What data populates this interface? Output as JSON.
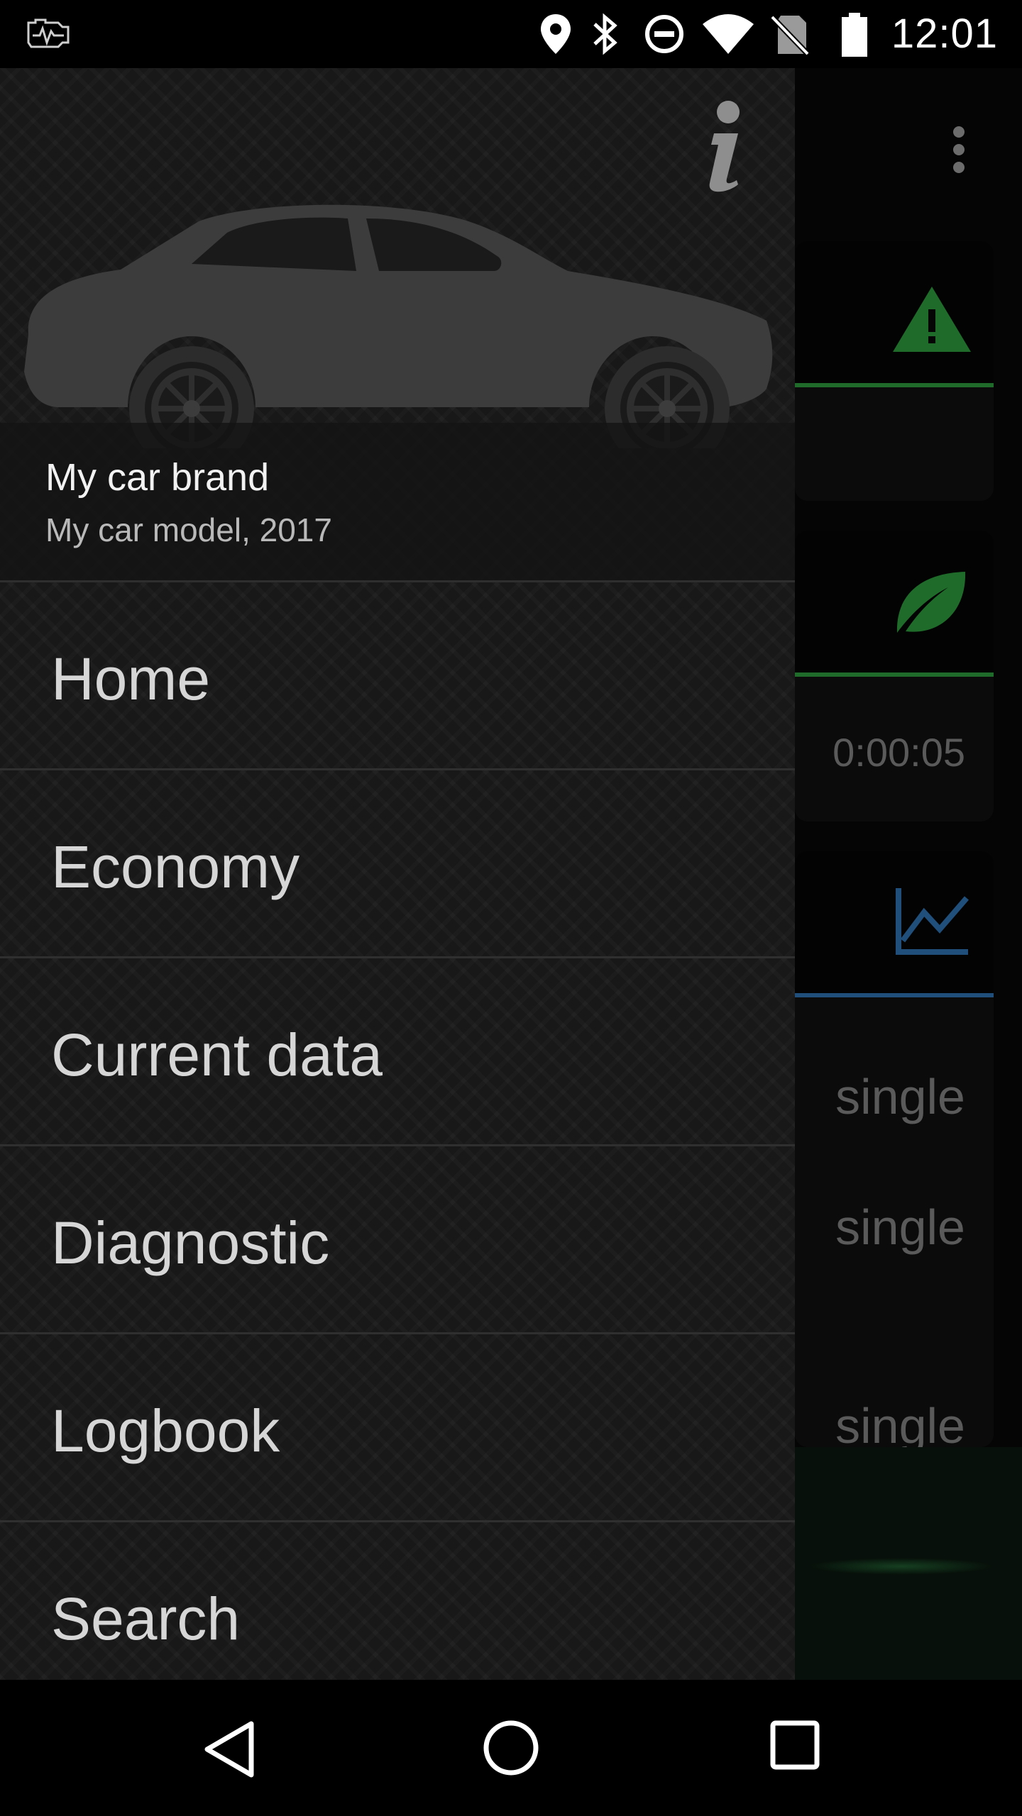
{
  "status_bar": {
    "time": "12:01",
    "icons": [
      "engine-monitor-icon",
      "location-pin-icon",
      "bluetooth-icon",
      "do-not-disturb-icon",
      "wifi-icon",
      "no-sim-icon",
      "battery-icon"
    ]
  },
  "drawer": {
    "header": {
      "brand": "My car brand",
      "model": "My car model, 2017",
      "info_icon": "info-icon",
      "dropdown_icon": "arrow-drop-down-icon"
    },
    "menu_items": [
      {
        "label": "Home"
      },
      {
        "label": "Economy"
      },
      {
        "label": "Current data"
      },
      {
        "label": "Diagnostic"
      },
      {
        "label": "Logbook"
      },
      {
        "label": "Search"
      }
    ]
  },
  "background_screen": {
    "overflow_icon": "more-vert-icon",
    "cards": [
      {
        "icon": "warning-icon",
        "accent": "#1e6b2a"
      },
      {
        "icon": "leaf-icon",
        "accent": "#1e6b2a",
        "value": "0:00:05"
      },
      {
        "icon": "chart-icon",
        "accent": "#1f4f7a"
      }
    ],
    "values": [
      "single",
      "single",
      "single"
    ]
  },
  "nav_bar": {
    "icons": [
      "back-icon",
      "home-icon",
      "recents-icon"
    ]
  },
  "colors": {
    "drawer_bg": "#181818",
    "menu_text": "#d6d6d6",
    "divider": "#2f2f2f",
    "green_accent": "#1e6b2a",
    "blue_accent": "#1f4f7a"
  }
}
